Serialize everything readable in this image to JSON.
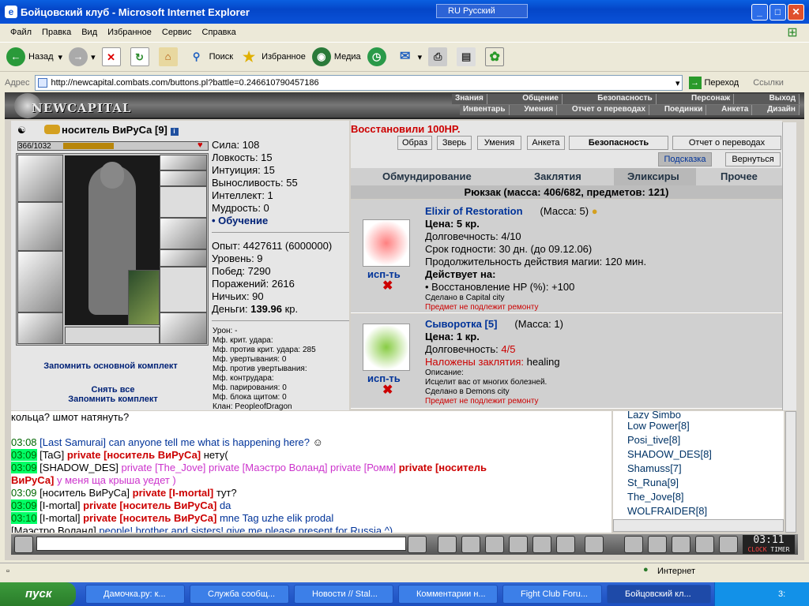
{
  "window": {
    "title": "Бойцовский клуб - Microsoft Internet Explorer",
    "lang": "RU Русский",
    "min": "_",
    "max": "□",
    "close": "✕"
  },
  "menu": [
    "Файл",
    "Правка",
    "Вид",
    "Избранное",
    "Сервис",
    "Справка"
  ],
  "toolbar": {
    "back": "Назад",
    "search": "Поиск",
    "favorites": "Избранное",
    "media": "Медиа"
  },
  "address": {
    "label": "Адрес",
    "url": "http://newcapital.combats.com/buttons.pl?battle=0.246610790457186",
    "go": "Переход",
    "links": "Ссылки"
  },
  "game": {
    "logo": "NEWCAPITAL",
    "nav1": [
      "Знания",
      "Общение",
      "Безопасность",
      "Персонаж",
      "Выход"
    ],
    "nav2": [
      "Инвентарь",
      "Умения",
      "Отчет о переводах",
      "Поединки",
      "Анкета",
      "Дизайн"
    ],
    "char": {
      "name": "носитель ВиРуСа",
      "level": "[9]",
      "hp": "366/1032",
      "hp_fraction": 0.35,
      "stats": [
        "Сила: 108",
        "Ловкость: 15",
        "Интуиция: 15",
        "Выносливость: 55",
        "Интеллект: 1",
        "Мудрость: 0"
      ],
      "training": "• Обучение",
      "exp": "Опыт: 4427611 (6000000)",
      "level_line": "Уровень: 9",
      "wins": "Побед: 7290",
      "losses": "Поражений: 2616",
      "draws": "Ничьих: 90",
      "money_label": "Деньги: ",
      "money_value": "139.96",
      "money_unit": " кр.",
      "combat": [
        "Урон: -",
        "Мф. крит. удара:",
        "Мф. против крит. удара: 285",
        "Мф. увертывания: 0",
        "Мф. против увертывания:",
        "Мф. контрудара:",
        "Мф. парирования: 0",
        "Мф. блока щитом: 0",
        "Клан: PeopleofDragon"
      ],
      "remember": "Запомнить основной комплект",
      "undress": "Снять все",
      "remember2": "Запомнить комплект"
    },
    "message": "Восстановили 100HP.",
    "buttons": [
      "Образ",
      "Зверь",
      "Умения",
      "Анкета",
      "Безопасность",
      "Отчет о переводах"
    ],
    "hint": "Подсказка",
    "back_btn": "Вернуться",
    "tabs": [
      "Обмундирование",
      "Заклятия",
      "Эликсиры",
      "Прочее"
    ],
    "backpack": "Рюкзак (масса: 406/682, предметов: 121)",
    "items": [
      {
        "name": "Elixir of Restoration",
        "mass": "(Масса: 5)",
        "price": "Цена: 5 кр.",
        "dur": "Долговечность: 4/10",
        "expiry": "Срок годности: 30 дн. (до 09.12.06)",
        "duration": "Продолжительность действия магии: 120 мин.",
        "acts": "Действует на:",
        "effect": "• Восстановление HP (%): +100",
        "made": "Сделано в Capital city",
        "norepair": "Предмет не подлежит ремонту",
        "use": "исп-ть"
      },
      {
        "name": "Сыворотка [5]",
        "mass": "(Масса: 1)",
        "price": "Цена: 1 кр.",
        "dur_label": "Долговечность: ",
        "dur_val": "4/5",
        "spell_label": "Наложены заклятия: ",
        "spell_val": "healing",
        "desc_label": "Описание:",
        "desc": "Исцелит вас от многих болезней.",
        "made": "Сделано в Demons city",
        "norepair": "Предмет не подлежит ремонту",
        "use": "исп-ть"
      }
    ],
    "chat": [
      {
        "plain": "кольца? шмот натянуть?"
      },
      {
        "plain": ""
      },
      {
        "time": "03:08",
        "hl": false,
        "who": "[Last Samurai]",
        "text": " can anyone tell me what is happening here?"
      },
      {
        "time": "03:09",
        "hl": true,
        "who": "[TaG]",
        "priv": " private [носитель ВиРуСа]",
        "text": " нету("
      },
      {
        "time": "03:09",
        "hl": true,
        "who": "[SHADOW_DES]",
        "mag": " private [The_Jove] private [Маэстро Воланд] private [Ромм]",
        "priv": " private [носитель"
      },
      {
        "cont_priv": "ВиРуСа]",
        "cont_mag": " у меня ща крыша уедет )"
      },
      {
        "time": "03:09",
        "hl": false,
        "who": "[носитель ВиРуСа]",
        "priv": " private [I-mortal]",
        "text": " тут?"
      },
      {
        "time": "03:09",
        "hl": true,
        "who": "[I-mortal]",
        "priv": " private [носитель ВиРуСа]",
        "text": " da"
      },
      {
        "time": "03:10",
        "hl": true,
        "who": "[I-mortal]",
        "priv": " private [носитель ВиРуСа]",
        "text": " mne Tag uzhe elik prodal"
      },
      {
        "time": "",
        "hl": false,
        "who": "[Маэстро Воланд]",
        "text": " people! brother and sisters! give me please present for Russia ^)"
      }
    ],
    "online": [
      "Low Power[8]",
      "Posi_tive[8]",
      "SHADOW_DES[8]",
      "Shamuss[7]",
      "St_Runa[9]",
      "The_Jove[8]",
      "WOLFRAIDER[8]"
    ],
    "online_top": "Lazy Simbo",
    "clock": "03:11",
    "clock_label": "CLOCK",
    "timer_label": "TIMER"
  },
  "status": {
    "zone": "Интернет"
  },
  "taskbar": {
    "start": "пуск",
    "tasks": [
      "Дамочка.ру: к...",
      "Служба сообщ...",
      "Новости // Stal...",
      "Комментарии н...",
      "Fight Club Foru...",
      "Бойцовский кл..."
    ],
    "time": "3:"
  }
}
